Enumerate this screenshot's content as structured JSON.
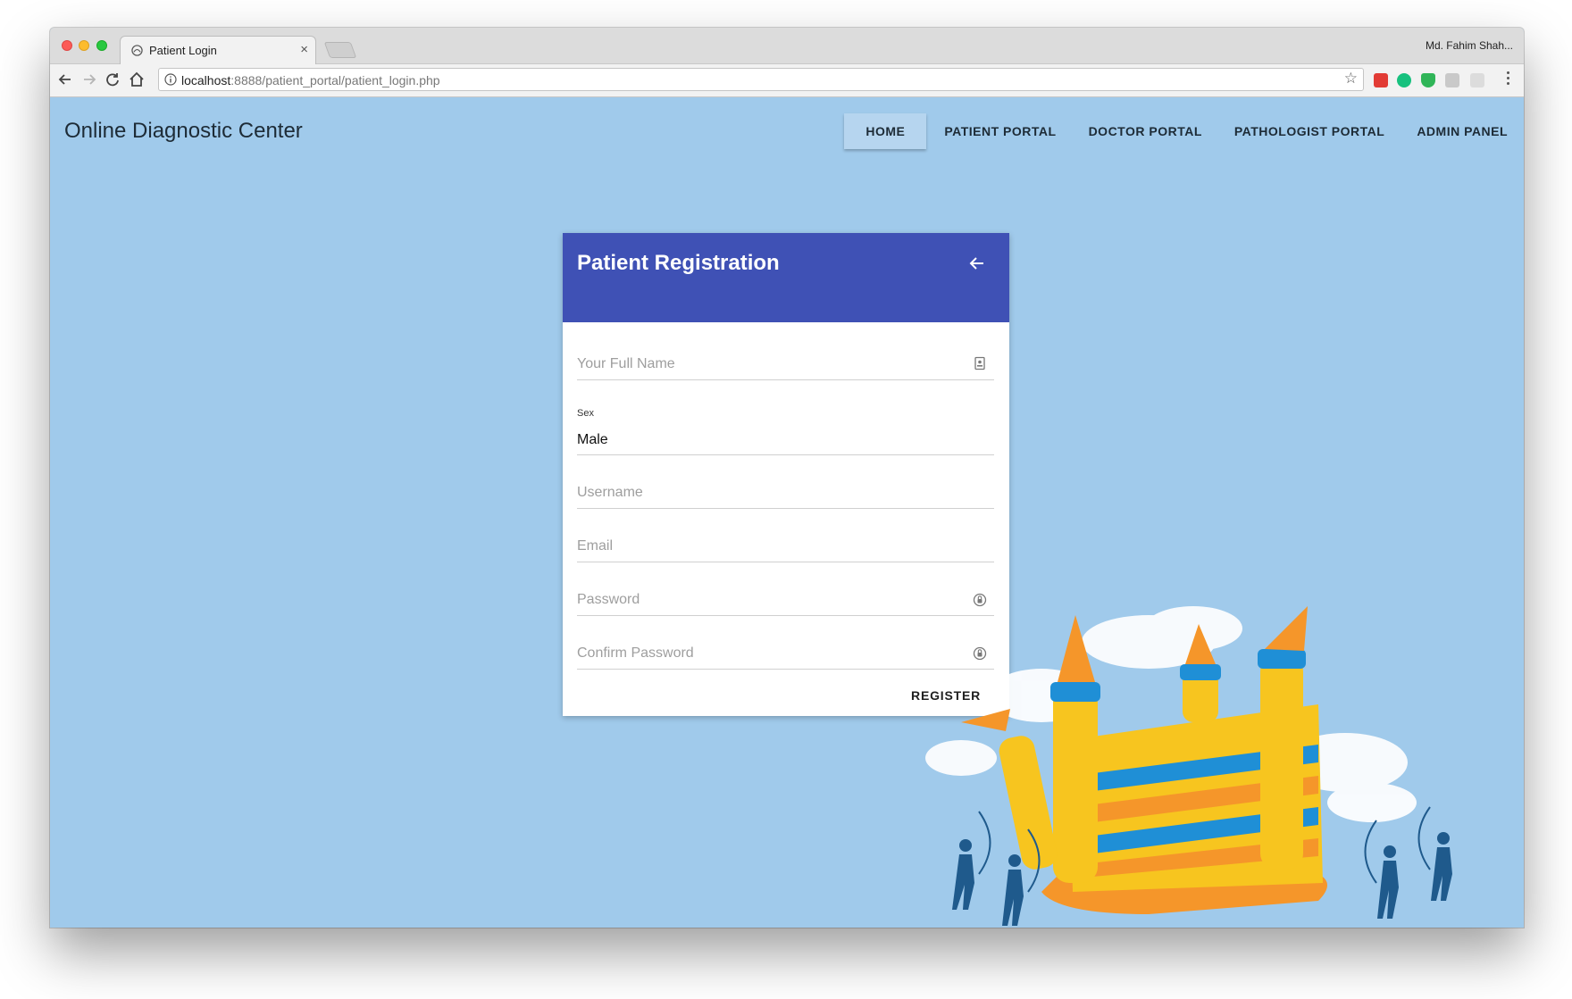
{
  "browser": {
    "tab_title": "Patient Login",
    "tab_close": "×",
    "profile_name": "Md. Fahim Shah...",
    "url_host": "localhost",
    "url_path": ":8888/patient_portal/patient_login.php",
    "bookmark_icon": "☆"
  },
  "site": {
    "brand": "Online Diagnostic Center",
    "nav": [
      {
        "label": "HOME",
        "active": true
      },
      {
        "label": "PATIENT PORTAL"
      },
      {
        "label": "DOCTOR PORTAL"
      },
      {
        "label": "PATHOLOGIST PORTAL"
      },
      {
        "label": "ADMIN PANEL"
      }
    ]
  },
  "form": {
    "title": "Patient Registration",
    "full_name_placeholder": "Your Full Name",
    "sex_label": "Sex",
    "sex_value": "Male",
    "username_placeholder": "Username",
    "email_placeholder": "Email",
    "password_placeholder": "Password",
    "confirm_password_placeholder": "Confirm Password",
    "register_label": "REGISTER"
  },
  "colors": {
    "page_background": "#a0caeb",
    "card_header": "#3f51b5",
    "castle_yellow": "#f7c51f",
    "castle_blue": "#1f8fd6",
    "castle_orange": "#f5962a",
    "archer_blue": "#1f5a8c"
  },
  "icons": {
    "back": "arrow-left-icon",
    "name_field": "contact-card-icon",
    "password_field": "lock-icon"
  }
}
